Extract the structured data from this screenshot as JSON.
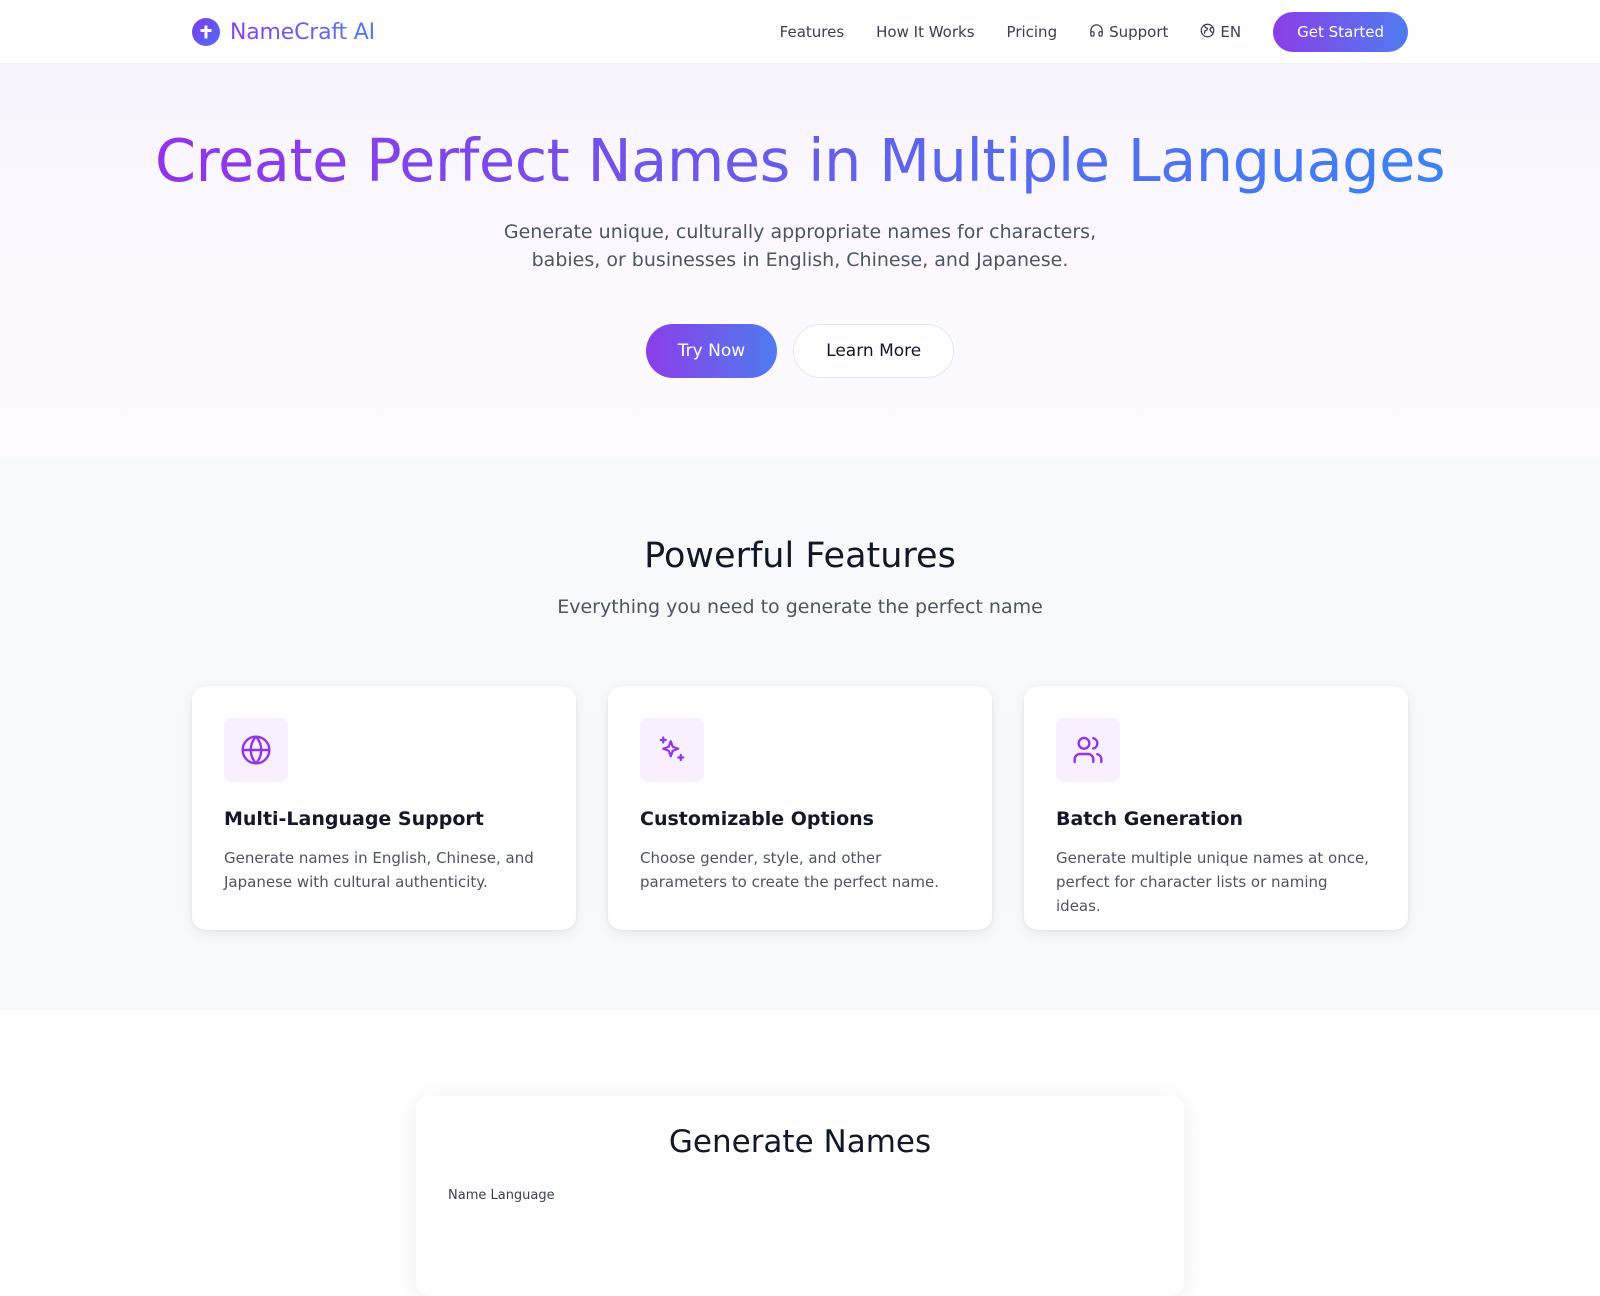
{
  "nav": {
    "brand": "NameCraft AI",
    "links": [
      {
        "label": "Features"
      },
      {
        "label": "How It Works"
      },
      {
        "label": "Pricing"
      },
      {
        "label": "Support",
        "icon": "headphones-icon"
      },
      {
        "label": "EN",
        "icon": "globe-icon"
      }
    ],
    "cta": "Get Started"
  },
  "hero": {
    "title": "Create Perfect Names in Multiple Languages",
    "subtitle": "Generate unique, culturally appropriate names for characters, babies, or businesses in English, Chinese, and Japanese.",
    "primary_button": "Try Now",
    "secondary_button": "Learn More"
  },
  "features": {
    "title": "Powerful Features",
    "subtitle": "Everything you need to generate the perfect name",
    "cards": [
      {
        "icon": "globe-icon",
        "title": "Multi-Language Support",
        "desc": "Generate names in English, Chinese, and Japanese with cultural authenticity."
      },
      {
        "icon": "sparkles-icon",
        "title": "Customizable Options",
        "desc": "Choose gender, style, and other parameters to create the perfect name."
      },
      {
        "icon": "users-icon",
        "title": "Batch Generation",
        "desc": "Generate multiple unique names at once, perfect for character lists or naming ideas."
      }
    ]
  },
  "generator": {
    "title": "Generate Names",
    "language_label": "Name Language"
  },
  "colors": {
    "accent_start": "#8b3ee8",
    "accent_end": "#4f7cf0",
    "icon_color": "#9333ea",
    "icon_bg": "#f8f0fe"
  }
}
